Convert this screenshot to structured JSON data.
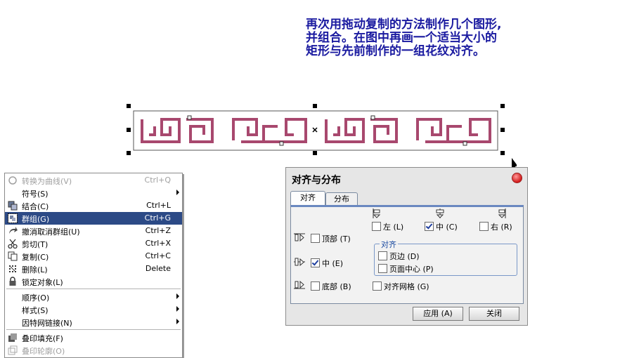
{
  "instruction": {
    "line1": "再次用拖动复制的方法制作几个图形,",
    "line2": "并组合。在图中再画一个适当大小的",
    "line3": "矩形与先前制作的一组花纹对齐。"
  },
  "colors": {
    "pattern": "#a8486e",
    "menu_highlight": "#2c4a86",
    "instruction_text": "#1a1aa0"
  },
  "context_menu": {
    "items": [
      {
        "label": "转换为曲线(V)",
        "shortcut": "Ctrl+Q",
        "icon": "convert-curve-icon"
      },
      {
        "label": "符号(S)",
        "submenu": true
      },
      {
        "label": "结合(C)",
        "shortcut": "Ctrl+L",
        "icon": "combine-icon"
      },
      {
        "label": "群组(G)",
        "shortcut": "Ctrl+G",
        "icon": "group-icon"
      },
      {
        "label": "撤消取消群组(U)",
        "shortcut": "Ctrl+Z",
        "icon": "undo-icon"
      },
      {
        "label": "剪切(T)",
        "shortcut": "Ctrl+X",
        "icon": "scissors-icon"
      },
      {
        "label": "复制(C)",
        "shortcut": "Ctrl+C",
        "icon": "copy-icon"
      },
      {
        "label": "删除(L)",
        "shortcut": "Delete",
        "icon": "delete-icon"
      },
      {
        "label": "锁定对象(L)",
        "icon": "lock-icon"
      },
      {
        "label": "顺序(O)",
        "submenu": true
      },
      {
        "label": "样式(S)",
        "submenu": true
      },
      {
        "label": "因特网链接(N)",
        "submenu": true
      },
      {
        "label": "叠印填充(F)",
        "icon": "overprint-fill-icon"
      },
      {
        "label": "叠印轮廓(O)",
        "icon": "overprint-outline-icon"
      }
    ]
  },
  "dialog": {
    "title": "对齐与分布",
    "tabs": [
      "对齐",
      "分布"
    ],
    "horizontal": {
      "left": "左 (L)",
      "center": "中 (C)",
      "right": "右 (R)"
    },
    "vertical": {
      "top": "顶部 (T)",
      "middle": "中 (E)",
      "bottom": "底部 (B)"
    },
    "align_to_group": {
      "title": "对齐",
      "page_edge": "页边 (D)",
      "page_center": "页面中心 (P)"
    },
    "align_to_grid": "对齐网格 (G)",
    "buttons": {
      "apply": "应用 (A)",
      "close": "关闭"
    },
    "checked": {
      "left": false,
      "center": true,
      "right": false,
      "top": false,
      "middle": true,
      "bottom": false,
      "page_edge": false,
      "page_center": false,
      "grid": false
    }
  }
}
